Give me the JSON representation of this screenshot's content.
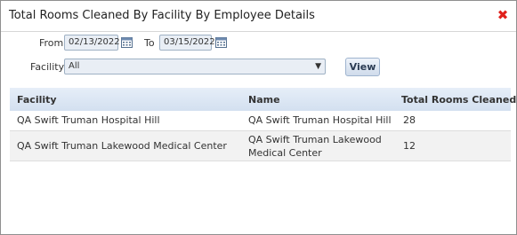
{
  "dialog": {
    "title": "Total Rooms Cleaned By Facility By Employee Details",
    "close_icon": "close-x-icon"
  },
  "filters": {
    "from_label": "From",
    "from_value": "02/13/2022",
    "to_label": "To",
    "to_value": "03/15/2022",
    "calendar_icon": "calendar-icon",
    "facility_label": "Facility:",
    "facility_value": "All",
    "view_label": "View"
  },
  "table": {
    "columns": [
      "Facility",
      "Name",
      "Total Rooms Cleaned"
    ],
    "rows": [
      {
        "facility": "QA Swift Truman Hospital Hill",
        "name": "QA Swift Truman Hospital Hill",
        "total": "28"
      },
      {
        "facility": "QA Swift Truman Lakewood Medical Center",
        "name": "QA Swift Truman Lakewood Medical Center",
        "total": "12"
      }
    ]
  },
  "colors": {
    "close": "#e0201b",
    "header_bg": "#d3e0f0",
    "input_bg": "#e9eef5",
    "alt_row": "#f2f2f2"
  }
}
